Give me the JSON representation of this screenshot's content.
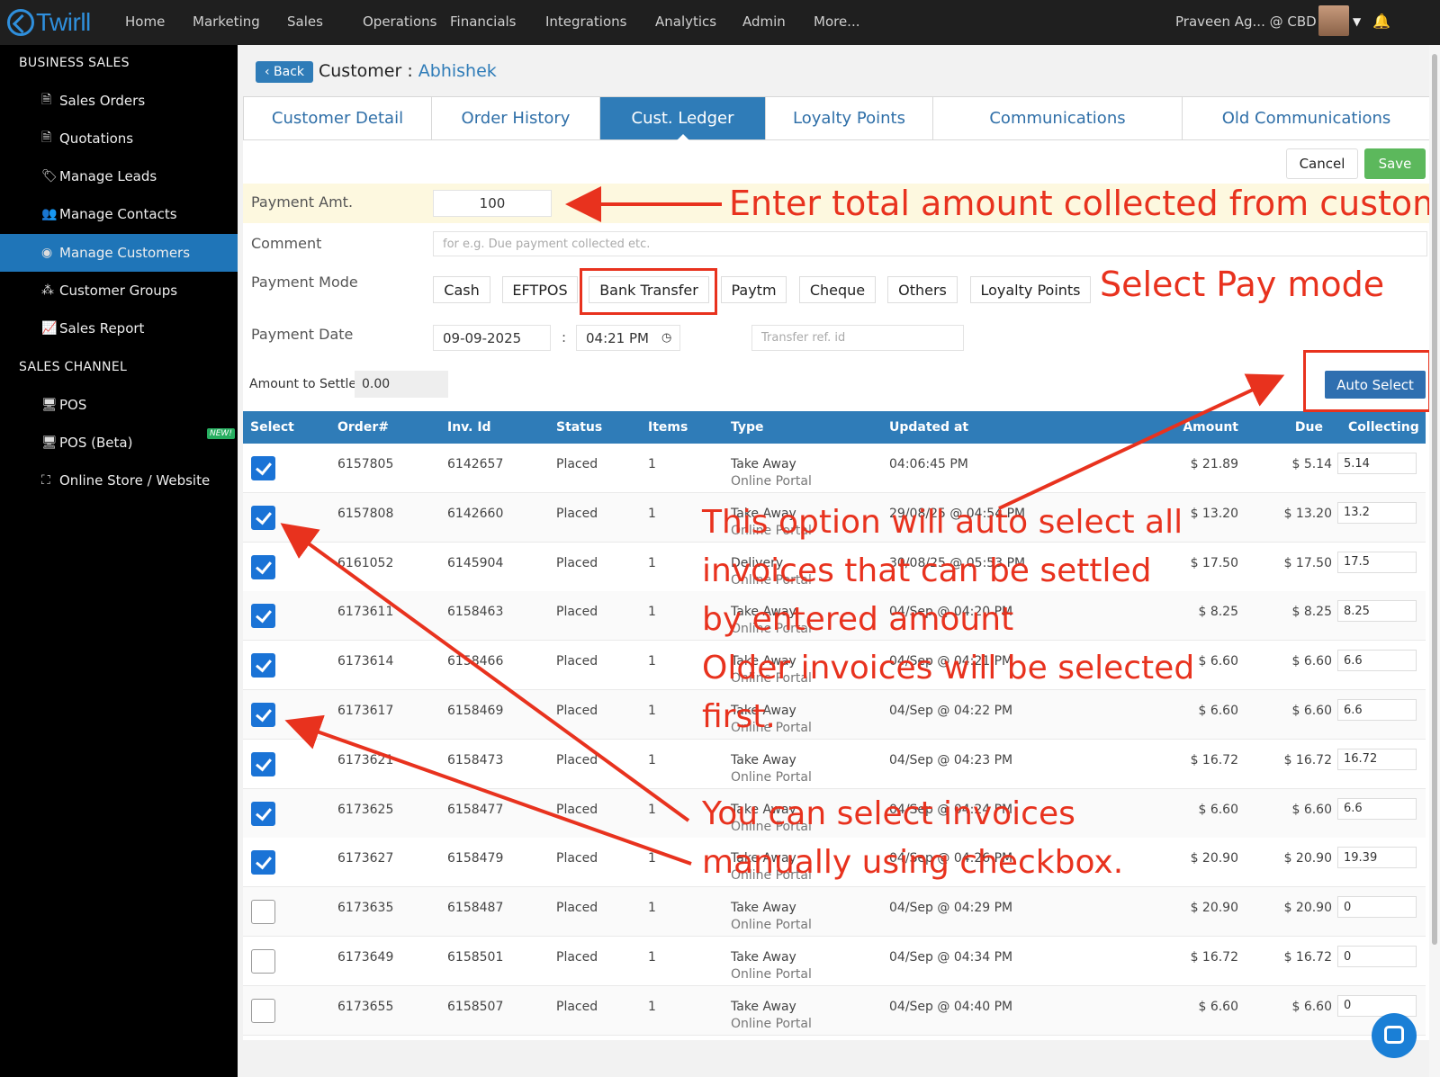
{
  "topbar": {
    "logo_text": "Twirll",
    "nav": [
      "Home",
      "Marketing",
      "Sales",
      "Operations",
      "Financials",
      "Integrations",
      "Analytics",
      "Admin",
      "More..."
    ],
    "user": "Praveen Ag... @ CBD"
  },
  "sidebar": {
    "section1": "BUSINESS SALES",
    "items1": [
      "Sales Orders",
      "Quotations",
      "Manage Leads",
      "Manage Contacts",
      "Manage Customers",
      "Customer Groups",
      "Sales Report"
    ],
    "section2": "SALES CHANNEL",
    "items2": [
      "POS",
      "POS (Beta)",
      "Online Store / Website"
    ],
    "new_badge": "NEW!"
  },
  "header": {
    "back": "Back",
    "title_prefix": "Customer :",
    "customer": "Abhishek"
  },
  "tabs": [
    "Customer Detail",
    "Order History",
    "Cust. Ledger",
    "Loyalty Points",
    "Communications",
    "Old Communications"
  ],
  "actions": {
    "cancel": "Cancel",
    "save": "Save",
    "auto_select": "Auto Select"
  },
  "form": {
    "payment_amt_label": "Payment Amt.",
    "payment_amt": "100",
    "comment_label": "Comment",
    "comment_placeholder": "for e.g. Due payment collected etc.",
    "payment_mode_label": "Payment Mode",
    "modes": [
      "Cash",
      "EFTPOS",
      "Bank Transfer",
      "Paytm",
      "Cheque",
      "Others",
      "Loyalty Points"
    ],
    "payment_date_label": "Payment Date",
    "date": "09-09-2025",
    "time_sep": ":",
    "time": "04:21 PM",
    "ref_placeholder": "Transfer ref. id",
    "settle_label": "Amount to Settle",
    "settle_value": "0.00"
  },
  "table": {
    "headers": [
      "Select",
      "Order#",
      "Inv. Id",
      "Status",
      "Items",
      "Type",
      "Updated at",
      "Amount",
      "Due",
      "Collecting"
    ],
    "rows": [
      {
        "checked": true,
        "order": "6157805",
        "inv": "6142657",
        "status": "Placed",
        "items": "1",
        "type": "Take Away",
        "source": "Online Portal",
        "updated": "04:06:45 PM",
        "amount": "$ 21.89",
        "due": "$ 5.14",
        "collecting": "5.14"
      },
      {
        "checked": true,
        "order": "6157808",
        "inv": "6142660",
        "status": "Placed",
        "items": "1",
        "type": "Take Away",
        "source": "Online Portal",
        "updated": "29/08/25 @ 04:54 PM",
        "amount": "$ 13.20",
        "due": "$ 13.20",
        "collecting": "13.2"
      },
      {
        "checked": true,
        "order": "6161052",
        "inv": "6145904",
        "status": "Placed",
        "items": "1",
        "type": "Delivery",
        "source": "Online Portal",
        "updated": "30/08/25 @ 05:53 PM",
        "amount": "$ 17.50",
        "due": "$ 17.50",
        "collecting": "17.5"
      },
      {
        "checked": true,
        "order": "6173611",
        "inv": "6158463",
        "status": "Placed",
        "items": "1",
        "type": "Take Away",
        "source": "Online Portal",
        "updated": "04/Sep @ 04:20 PM",
        "amount": "$ 8.25",
        "due": "$ 8.25",
        "collecting": "8.25"
      },
      {
        "checked": true,
        "order": "6173614",
        "inv": "6158466",
        "status": "Placed",
        "items": "1",
        "type": "Take Away",
        "source": "Online Portal",
        "updated": "04/Sep @ 04:21 PM",
        "amount": "$ 6.60",
        "due": "$ 6.60",
        "collecting": "6.6"
      },
      {
        "checked": true,
        "order": "6173617",
        "inv": "6158469",
        "status": "Placed",
        "items": "1",
        "type": "Take Away",
        "source": "Online Portal",
        "updated": "04/Sep @ 04:22 PM",
        "amount": "$ 6.60",
        "due": "$ 6.60",
        "collecting": "6.6"
      },
      {
        "checked": true,
        "order": "6173621",
        "inv": "6158473",
        "status": "Placed",
        "items": "1",
        "type": "Take Away",
        "source": "Online Portal",
        "updated": "04/Sep @ 04:23 PM",
        "amount": "$ 16.72",
        "due": "$ 16.72",
        "collecting": "16.72"
      },
      {
        "checked": true,
        "order": "6173625",
        "inv": "6158477",
        "status": "Placed",
        "items": "1",
        "type": "Take Away",
        "source": "Online Portal",
        "updated": "04/Sep @ 04:24 PM",
        "amount": "$ 6.60",
        "due": "$ 6.60",
        "collecting": "6.6"
      },
      {
        "checked": true,
        "order": "6173627",
        "inv": "6158479",
        "status": "Placed",
        "items": "1",
        "type": "Take Away",
        "source": "Online Portal",
        "updated": "04/Sep @ 04:26 PM",
        "amount": "$ 20.90",
        "due": "$ 20.90",
        "collecting": "19.39"
      },
      {
        "checked": false,
        "order": "6173635",
        "inv": "6158487",
        "status": "Placed",
        "items": "1",
        "type": "Take Away",
        "source": "Online Portal",
        "updated": "04/Sep @ 04:29 PM",
        "amount": "$ 20.90",
        "due": "$ 20.90",
        "collecting": "0"
      },
      {
        "checked": false,
        "order": "6173649",
        "inv": "6158501",
        "status": "Placed",
        "items": "1",
        "type": "Take Away",
        "source": "Online Portal",
        "updated": "04/Sep @ 04:34 PM",
        "amount": "$ 16.72",
        "due": "$ 16.72",
        "collecting": "0"
      },
      {
        "checked": false,
        "order": "6173655",
        "inv": "6158507",
        "status": "Placed",
        "items": "1",
        "type": "Take Away",
        "source": "Online Portal",
        "updated": "04/Sep @ 04:40 PM",
        "amount": "$ 6.60",
        "due": "$ 6.60",
        "collecting": "0"
      }
    ]
  },
  "annotations": {
    "amount": "Enter total amount collected from customer",
    "paymode": "Select Pay mode",
    "auto": [
      "This option will auto select all",
      "invoices that can be settled",
      "by entered amount",
      "Older invoices will be selected",
      "first."
    ],
    "manual": [
      "You can select invoices",
      "manually using checkbox."
    ]
  },
  "colors": {
    "accent": "#2f7cb8",
    "annotation": "#e8321e",
    "save": "#5cb85c",
    "sidebar_active": "#1f75b8"
  }
}
